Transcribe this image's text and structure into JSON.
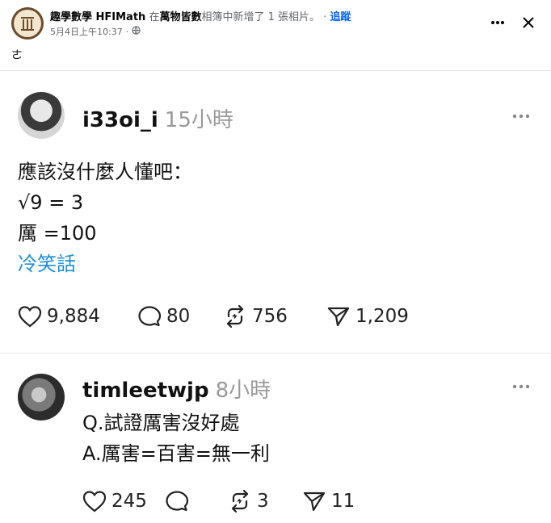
{
  "fb": {
    "page_name": "趣學數學 HFIMath",
    "connector": " 在",
    "album_name": "萬物皆數",
    "action_text": "相簿中新增了 1 張相片。",
    "dot_sep": " · ",
    "follow_label": "追蹤",
    "timestamp": "5月4日上午10:37",
    "time_sep": "·",
    "caption": "ㄜ",
    "icons": {
      "more": "more-horizontal-icon",
      "close": "close-icon",
      "audience": "globe-icon"
    }
  },
  "posts": [
    {
      "username": "i33oi_i",
      "time": "15小時",
      "lines": [
        "應該沒什麼人懂吧：",
        "√9 = 3",
        "厲 =100"
      ],
      "tag": "冷笑話",
      "likes": "9,884",
      "comments": "80",
      "reposts": "756",
      "shares": "1,209"
    },
    {
      "username": "timleetwjp",
      "time": "8小時",
      "lines": [
        "Q.試證厲害沒好處",
        "A.厲害=百害=無一利"
      ],
      "likes": "245",
      "comments": "",
      "reposts": "3",
      "shares": "11"
    }
  ],
  "colors": {
    "link": "#1a8fd8",
    "follow": "#0866ff",
    "muted": "#65676b"
  }
}
